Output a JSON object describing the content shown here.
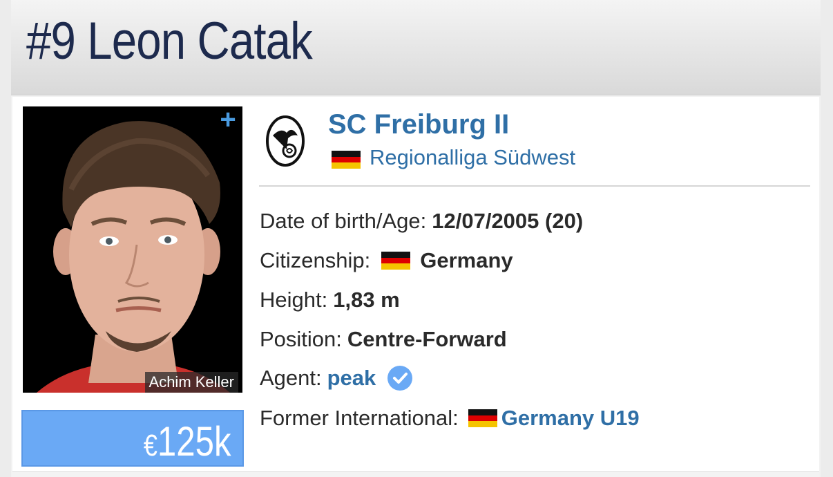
{
  "player": {
    "number_name": "#9 Leon Catak",
    "photo_credit": "Achim Keller",
    "market_value_currency": "€",
    "market_value_amount": "125k"
  },
  "club": {
    "name": "SC Freiburg II",
    "league": "Regionalliga Südwest",
    "league_flag": "germany-flag"
  },
  "info": {
    "dob_label": "Date of birth/Age:",
    "dob_value": "12/07/2005 (20)",
    "citizenship_label": "Citizenship:",
    "citizenship_value": "Germany",
    "height_label": "Height:",
    "height_value": "1,83 m",
    "position_label": "Position:",
    "position_value": "Centre-Forward",
    "agent_label": "Agent:",
    "agent_value": "peak",
    "former_intl_label": "Former International:",
    "former_intl_value": "Germany U19"
  },
  "icons": {
    "plus": "plus-icon",
    "verified": "verified-check-icon",
    "crest": "club-crest-icon"
  },
  "colors": {
    "link_blue": "#2f6fa6",
    "value_box": "#6aa9f5",
    "title_navy": "#1d2a4d"
  }
}
